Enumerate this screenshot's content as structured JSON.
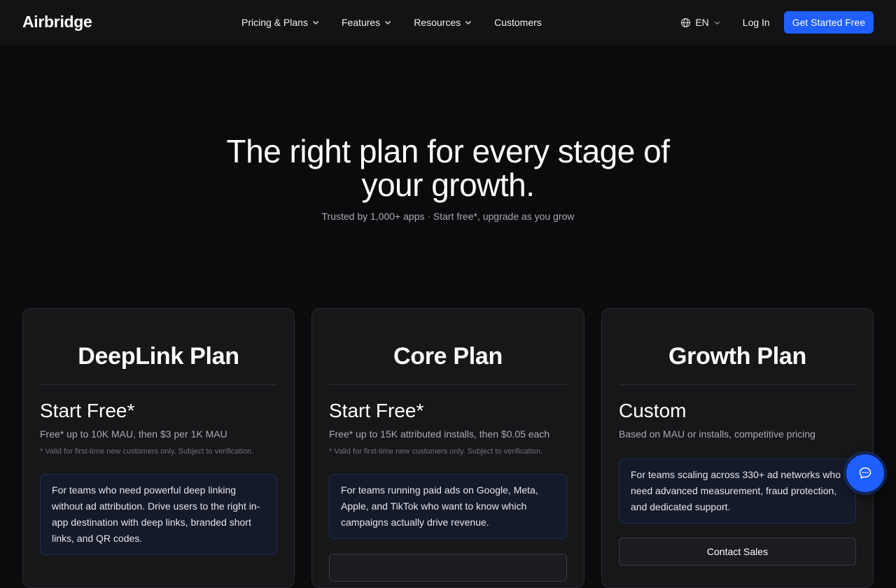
{
  "nav": {
    "logo": "Airbridge",
    "items": [
      {
        "label": "Pricing & Plans",
        "dropdown": true
      },
      {
        "label": "Features",
        "dropdown": true
      },
      {
        "label": "Resources",
        "dropdown": true
      },
      {
        "label": "Customers",
        "dropdown": false
      }
    ],
    "language": "EN",
    "login": "Log In",
    "cta": "Get Started Free"
  },
  "hero": {
    "title_line1": "The right plan for every stage of",
    "title_line2": "your growth.",
    "subtitle": "Trusted by 1,000+ apps · Start free*, upgrade as you grow"
  },
  "plans": [
    {
      "name": "DeepLink Plan",
      "price": "Start Free*",
      "price_note": "Free* up to 10K MAU, then $3 per 1K MAU",
      "fine_print": "* Valid for first-time new customers only. Subject to verification.",
      "description": "For teams who need powerful deep linking without ad attribution. Drive users to the right in-app destination with deep links, branded short links, and QR codes."
    },
    {
      "name": "Core Plan",
      "price": "Start Free*",
      "price_note": "Free* up to 15K attributed installs, then $0.05 each",
      "fine_print": "* Valid for first-time new customers only. Subject to verification.",
      "description": "For teams running paid ads on Google, Meta, Apple, and TikTok who want to know which campaigns actually drive revenue."
    },
    {
      "name": "Growth Plan",
      "price": "Custom",
      "price_note": "Based on MAU or installs, competitive pricing",
      "description": "For teams scaling across 330+ ad networks who need advanced measurement, fraud protection, and dedicated support.",
      "button": "Contact Sales"
    }
  ],
  "colors": {
    "accent": "#1f5eff",
    "background": "#0b0b0d",
    "card": "#17171a"
  },
  "icons": {
    "chat": "chat-bubble-icon",
    "language": "globe-icon"
  }
}
